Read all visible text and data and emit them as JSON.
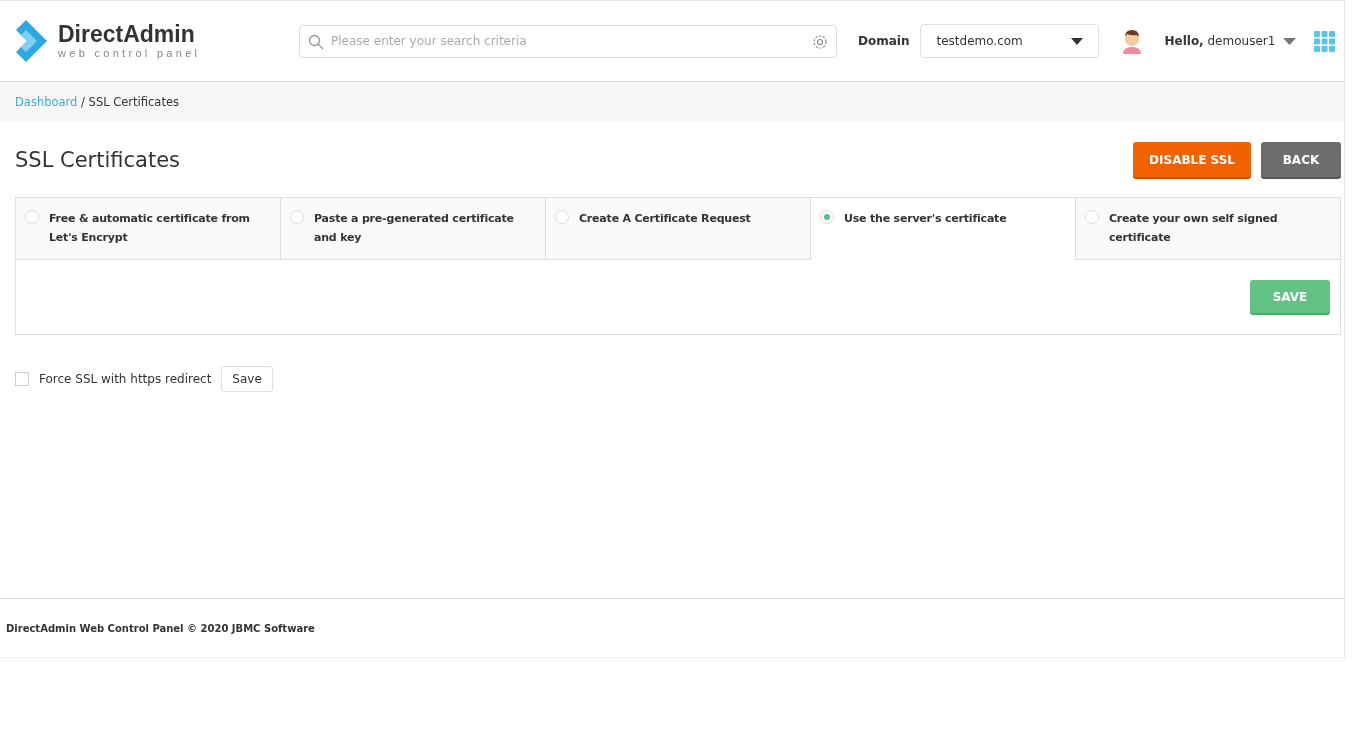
{
  "header": {
    "logo_title": "DirectAdmin",
    "logo_subtitle": "web control panel",
    "search": {
      "placeholder": "Please enter your search criteria"
    },
    "domain_label": "Domain",
    "domain_value": "testdemo.com",
    "greeting": "**Hello,** demouser1"
  },
  "breadcrumb": {
    "link": "Dashboard",
    "current": " / SSL Certificates"
  },
  "page_title": "SSL Certificates",
  "actions": [
    {
      "label": "DISABLE SSL",
      "kind": "danger"
    },
    {
      "label": "BACK",
      "kind": "neutral"
    }
  ],
  "tabs": [
    {
      "label": "Free & automatic certificate from Let's Encrypt",
      "selected": false
    },
    {
      "label": "Paste a pre-generated certificate and key",
      "selected": false
    },
    {
      "label": "Create A Certificate Request",
      "selected": false
    },
    {
      "label": "Use the server's certificate",
      "selected": true
    },
    {
      "label": "Create your own self signed certificate",
      "selected": false
    }
  ],
  "save_button": "SAVE",
  "force_ssl": {
    "label": "Force SSL with https redirect",
    "checked": false,
    "button": "Save"
  },
  "footer": "DirectAdmin Web Control Panel © 2020 JBMC Software"
}
